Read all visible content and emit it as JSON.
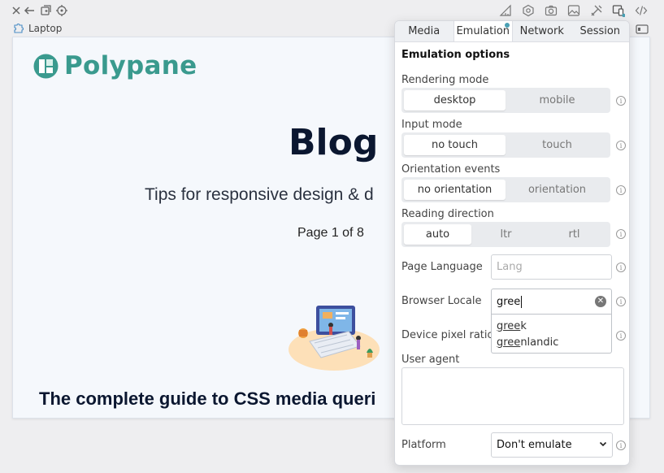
{
  "toolbar": {
    "left_icons": [
      "close-icon",
      "back-arrow-icon",
      "duplicate-icon",
      "target-icon"
    ],
    "right_icons": [
      "ruler-icon",
      "hexagon-icon",
      "camera-icon",
      "image-icon",
      "tools-icon",
      "device-emulation-icon",
      "code-icon"
    ]
  },
  "pane": {
    "label": "Laptop"
  },
  "site": {
    "logo_text": "Polypane",
    "title": "Blog",
    "subtitle": "Tips for responsive design & d",
    "page_info": "Page 1 of 8",
    "article_title": "The complete guide to CSS media queri",
    "brand_color": "#3a9a8e"
  },
  "panel": {
    "tabs": [
      {
        "label": "Media"
      },
      {
        "label": "Emulation"
      },
      {
        "label": "Network"
      },
      {
        "label": "Session"
      }
    ],
    "active_tab": "Emulation",
    "section_title": "Emulation options",
    "rendering_mode": {
      "label": "Rendering mode",
      "options": [
        "desktop",
        "mobile"
      ],
      "selected": "desktop"
    },
    "input_mode": {
      "label": "Input mode",
      "options": [
        "no touch",
        "touch"
      ],
      "selected": "no touch"
    },
    "orientation_events": {
      "label": "Orientation events",
      "options": [
        "no orientation",
        "orientation"
      ],
      "selected": "no orientation"
    },
    "reading_direction": {
      "label": "Reading direction",
      "options": [
        "auto",
        "ltr",
        "rtl"
      ],
      "selected": "auto"
    },
    "page_language": {
      "label": "Page Language",
      "placeholder": "Lang",
      "value": ""
    },
    "browser_locale": {
      "label": "Browser Locale",
      "value": "gree",
      "suggestions": [
        {
          "match": "gree",
          "rest": "k"
        },
        {
          "match": "gree",
          "rest": "nlandic"
        }
      ]
    },
    "device_pixel_ratio": {
      "label": "Device pixel ratio"
    },
    "user_agent": {
      "label": "User agent",
      "value": ""
    },
    "platform": {
      "label": "Platform",
      "value": "Don't emulate"
    },
    "info_glyph": "i",
    "accent_color": "#4aa0b4"
  }
}
